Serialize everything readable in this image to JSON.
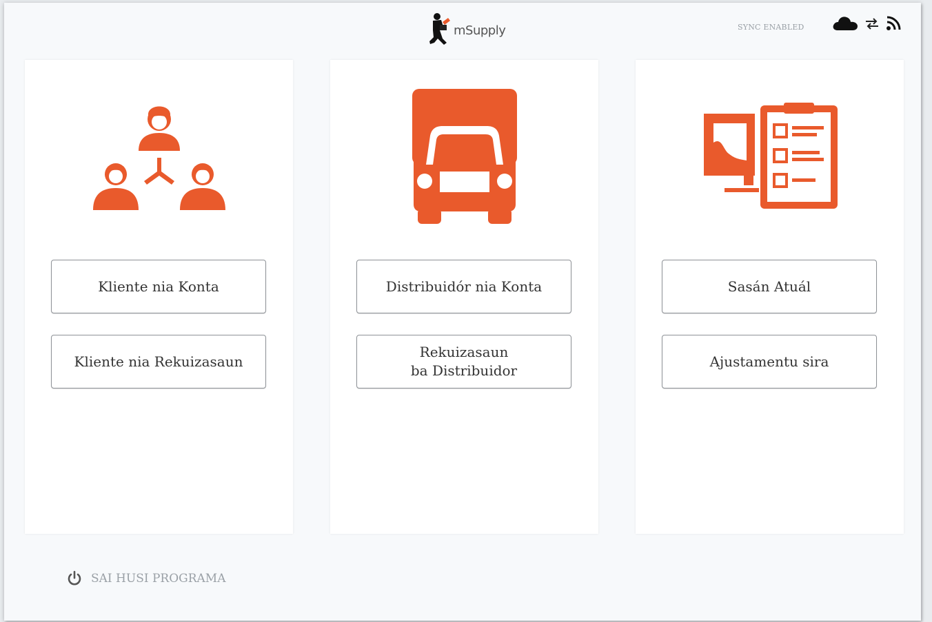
{
  "header": {
    "logo_text": "mSupply",
    "sync_status": "SYNC ENABLED",
    "status_icons": [
      "cloud-icon",
      "sync-arrows-icon",
      "rss-icon"
    ]
  },
  "colors": {
    "accent": "#e95a2c",
    "background": "#f7f9fb"
  },
  "cards": [
    {
      "icon": "customers-network-icon",
      "buttons": [
        "Kliente nia Konta",
        "Kliente nia Rekuizasaun"
      ]
    },
    {
      "icon": "truck-icon",
      "buttons": [
        "Distribuidór nia Konta",
        "Rekuizasaun\nba Distribuidor"
      ]
    },
    {
      "icon": "stocktake-icon",
      "buttons": [
        "Sasán Atuál",
        "Ajustamentu sira"
      ]
    }
  ],
  "footer": {
    "exit_label": "SAI HUSI PROGRAMA"
  }
}
